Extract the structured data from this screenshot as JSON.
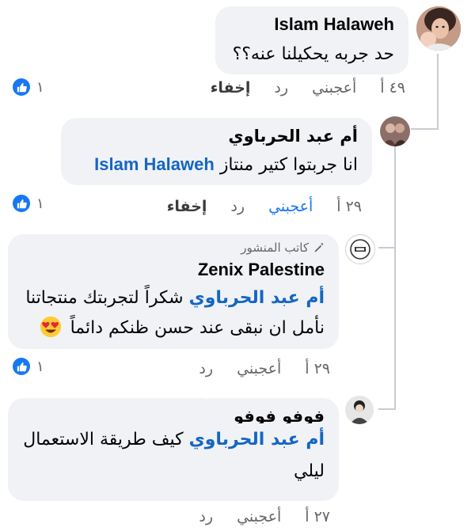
{
  "comments": [
    {
      "author": "Islam Halaweh",
      "text": "حد جربه يحكيلنا عنه؟؟",
      "time": "٤٩ أ",
      "like_label": "أعجبني",
      "reply_label": "رد",
      "hide_label": "إخفاء",
      "reaction_count": "١"
    },
    {
      "author": "أم عبد الحرباوي",
      "mention": "Islam Halaweh",
      "text": "انا جربتوا كتير منتاز",
      "time": "٢٩ أ",
      "like_label": "أعجبني",
      "reply_label": "رد",
      "hide_label": "إخفاء",
      "reaction_count": "١"
    },
    {
      "badge": "كاتب المنشور",
      "author": "Zenix Palestine",
      "mention": "أم عبد الحرباوي",
      "text_line1": "شكراً لتجربتك منتجاتنا",
      "text_line2": "نأمل ان نبقى عند حسن ظنكم دائماً",
      "time": "٢٩ أ",
      "like_label": "أعجبني",
      "reply_label": "رد",
      "reaction_count": "١"
    },
    {
      "author": "فوفو فوفو",
      "mention": "أم عبد الحرباوي",
      "text_line1": "كيف طريقة الاستعمال",
      "text_line2": "ليلي",
      "time": "٢٧ أ",
      "like_label": "أعجبني",
      "reply_label": "رد"
    }
  ],
  "colors": {
    "bubble": "#f0f2f5",
    "mention": "#1466c4",
    "like_blue": "#1877f2",
    "meta_gray": "#65676b"
  },
  "icons": [
    "pencil-icon",
    "thumbs-up-icon",
    "heart-eyes-emoji-icon"
  ]
}
